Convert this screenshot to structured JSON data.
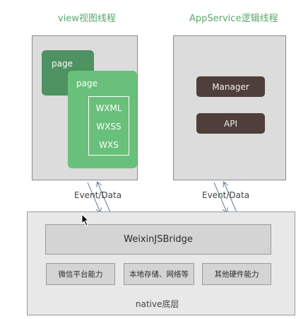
{
  "view_thread": {
    "title": "view视图线程",
    "page_back_label": "page",
    "page_front_label": "page",
    "files": [
      "WXML",
      "WXSS",
      "WXS"
    ]
  },
  "app_thread": {
    "title": "AppService逻辑线程",
    "items": [
      "Manager",
      "API"
    ]
  },
  "connections": {
    "left_label": "Event/Data",
    "right_label": "Event/Data"
  },
  "native": {
    "bridge": "WeixinJSBridge",
    "capabilities": [
      "微信平台能力",
      "本地存储、网络等",
      "其他硬件能力"
    ],
    "label": "native底层"
  },
  "colors": {
    "page_dark": "#4d9260",
    "page_light": "#69c07a",
    "title_green": "#5aa86a",
    "dark_button": "#4e3f3a",
    "arrow": "#5f7f95"
  }
}
